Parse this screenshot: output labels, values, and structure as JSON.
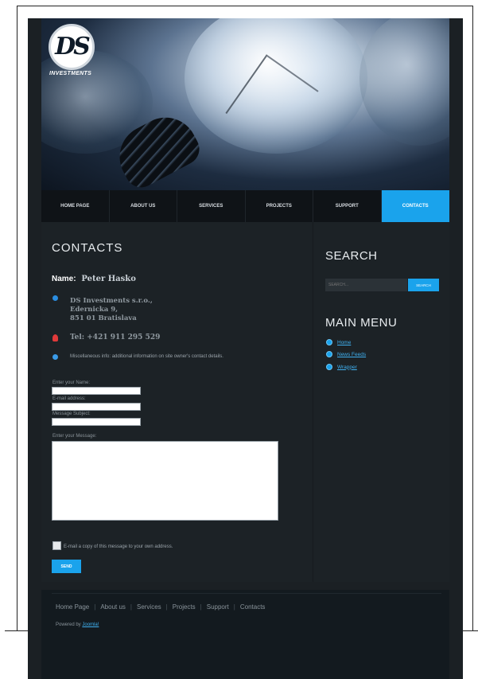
{
  "header": {
    "logo_mark": "DS",
    "logo_text": "INVESTMENTS"
  },
  "nav": {
    "items": [
      {
        "label": "HOME PAGE"
      },
      {
        "label": "ABOUT US"
      },
      {
        "label": "SERVICES"
      },
      {
        "label": "PROJECTS"
      },
      {
        "label": "SUPPORT"
      },
      {
        "label": "CONTACTS",
        "active": true
      }
    ]
  },
  "contact": {
    "title": "CONTACTS",
    "name_label": "Name:",
    "name_value": "Peter Hasko",
    "address_lines": [
      "DS Investments s.r.o.,",
      "Edernicka 9,",
      "851 01 Bratislava"
    ],
    "tel": "Tel: +421 911 295 529",
    "misc": "Miscellaneous info: additional information on site owner's contact details.",
    "icon_colors": {
      "address": "#2a8de0",
      "tel": "#e03a3a",
      "misc": "#3a9be8"
    }
  },
  "form": {
    "name_label": "Enter your Name:",
    "email_label": "E-mail address:",
    "subject_label": "Message Subject:",
    "message_label": "Enter your Message:",
    "copy_label": "E-mail a copy of this message to your own address.",
    "send_label": "SEND"
  },
  "sidebar": {
    "search_title": "SEARCH",
    "search_placeholder": "SEARCH...",
    "search_button": "SEARCH",
    "menu_title": "MAIN MENU",
    "menu_items": [
      {
        "label": "Home"
      },
      {
        "label": "News Feeds"
      },
      {
        "label": "Wrapper"
      }
    ]
  },
  "footer": {
    "links": [
      "Home Page",
      "About us",
      "Services",
      "Projects",
      "Support",
      "Contacts"
    ],
    "powered_by": "Powered by",
    "powered_link": "Joomla!"
  },
  "colors": {
    "accent": "#1aa3ec",
    "background": "#1c2226"
  }
}
